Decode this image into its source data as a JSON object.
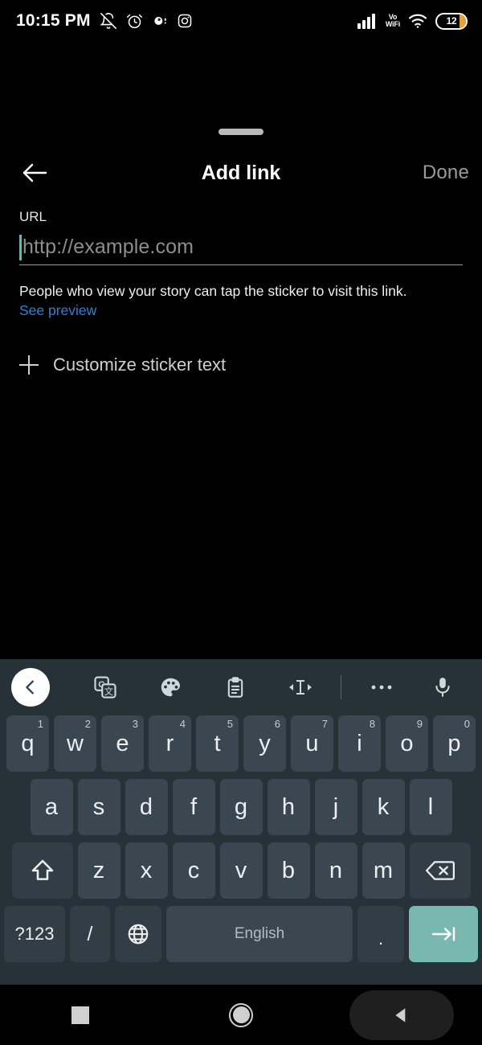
{
  "status_bar": {
    "time": "10:15 PM",
    "left_icons": [
      "bell-off-icon",
      "alarm-clock-icon",
      "media-dot-icon",
      "instagram-icon"
    ],
    "network_label": "Vo\nWiFi",
    "network_label_line1": "Vo",
    "network_label_line2": "WiFi",
    "right_icons": [
      "signal-bars-icon",
      "vowifi-label",
      "wifi-icon",
      "battery-icon"
    ],
    "battery_level": "12"
  },
  "sheet": {
    "header": {
      "back_icon": "arrow-left-icon",
      "title": "Add link",
      "done_label": "Done"
    },
    "url_field": {
      "label": "URL",
      "value": "",
      "placeholder": "http://example.com",
      "caret_color": "#6fb3aa"
    },
    "helper_text": "People who view your story can tap the sticker to visit this link.",
    "see_preview_label": "See preview",
    "see_preview_color": "#2f81d6",
    "customize": {
      "icon": "plus-icon",
      "label": "Customize sticker text"
    }
  },
  "keyboard": {
    "background": "#263238",
    "toolbar": [
      {
        "name": "collapse-toolbar-button",
        "icon": "chevron-left-icon"
      },
      {
        "name": "google-translate-button",
        "icon": "google-translate-icon"
      },
      {
        "name": "theme-button",
        "icon": "palette-icon"
      },
      {
        "name": "clipboard-button",
        "icon": "clipboard-icon"
      },
      {
        "name": "text-editing-button",
        "icon": "text-cursor-move-icon"
      },
      {
        "name": "toolbar-divider",
        "icon": "divider"
      },
      {
        "name": "more-options-button",
        "icon": "overflow-dots-icon"
      },
      {
        "name": "voice-input-button",
        "icon": "microphone-icon"
      }
    ],
    "row1": [
      {
        "key": "q",
        "hint": "1"
      },
      {
        "key": "w",
        "hint": "2"
      },
      {
        "key": "e",
        "hint": "3"
      },
      {
        "key": "r",
        "hint": "4"
      },
      {
        "key": "t",
        "hint": "5"
      },
      {
        "key": "y",
        "hint": "6"
      },
      {
        "key": "u",
        "hint": "7"
      },
      {
        "key": "i",
        "hint": "8"
      },
      {
        "key": "o",
        "hint": "9"
      },
      {
        "key": "p",
        "hint": "0"
      }
    ],
    "row2": [
      {
        "key": "a"
      },
      {
        "key": "s"
      },
      {
        "key": "d"
      },
      {
        "key": "f"
      },
      {
        "key": "g"
      },
      {
        "key": "h"
      },
      {
        "key": "j"
      },
      {
        "key": "k"
      },
      {
        "key": "l"
      }
    ],
    "row3": [
      {
        "key": "z"
      },
      {
        "key": "x"
      },
      {
        "key": "c"
      },
      {
        "key": "v"
      },
      {
        "key": "b"
      },
      {
        "key": "n"
      },
      {
        "key": "m"
      }
    ],
    "shift_icon": "shift-arrow-icon",
    "backspace_icon": "backspace-icon",
    "row4": {
      "symbols_label": "?123",
      "slash_label": "/",
      "globe_icon": "globe-icon",
      "space_label": "English",
      "period_label": ".",
      "enter_icon": "tab-arrow-icon",
      "enter_color": "#79b8b0"
    }
  },
  "nav_bar": {
    "recents_icon": "square-icon",
    "home_icon": "circle-icon",
    "back_icon": "triangle-back-icon"
  }
}
